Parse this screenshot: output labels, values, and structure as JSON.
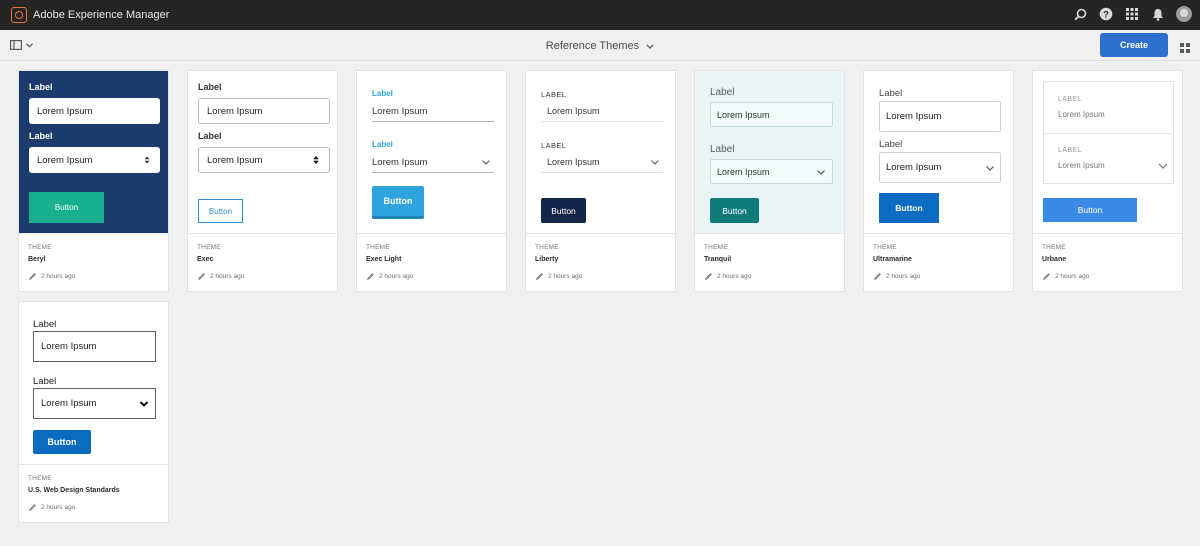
{
  "app": {
    "title": "Adobe Experience Manager"
  },
  "toolbar": {
    "page_title": "Reference Themes",
    "create_label": "Create"
  },
  "meta_kind_label": "THEME",
  "themes": [
    {
      "name": "Beryl",
      "time": "2 hours ago",
      "label1": "Label",
      "field1": "Lorem Ipsum",
      "label2": "Label",
      "field2": "Lorem Ipsum",
      "button": "Button"
    },
    {
      "name": "Exec",
      "time": "2 hours ago",
      "label1": "Label",
      "field1": "Lorem Ipsum",
      "label2": "Label",
      "field2": "Lorem Ipsum",
      "button": "Button"
    },
    {
      "name": "Exec Light",
      "time": "2 hours ago",
      "label1": "Label",
      "field1": "Lorem Ipsum",
      "label2": "Label",
      "field2": "Lorem Ipsum",
      "button": "Button"
    },
    {
      "name": "Liberty",
      "time": "2 hours ago",
      "label1": "LABEL",
      "field1": "Lorem Ipsum",
      "label2": "LABEL",
      "field2": "Lorem Ipsum",
      "button": "Button"
    },
    {
      "name": "Tranquil",
      "time": "2 hours ago",
      "label1": "Label",
      "field1": "Lorem Ipsum",
      "label2": "Label",
      "field2": "Lorem Ipsum",
      "button": "Button"
    },
    {
      "name": "Ultramarine",
      "time": "2 hours ago",
      "label1": "Label",
      "field1": "Lorem Ipsum",
      "label2": "Label",
      "field2": "Lorem Ipsum",
      "button": "Button"
    },
    {
      "name": "Urbane",
      "time": "2 hours ago",
      "label1": "LABEL",
      "field1": "Lorem Ipsum",
      "label2": "LABEL",
      "field2": "Lorem Ipsum",
      "button": "Button"
    },
    {
      "name": "U.S. Web Design Standards",
      "time": "2 hours ago",
      "label1": "Label",
      "field1": "Lorem Ipsum",
      "label2": "Label",
      "field2": "Lorem Ipsum",
      "button": "Button"
    }
  ],
  "colors": {
    "topbar": "#252525",
    "create_button": "#2d6fcc",
    "beryl_bg": "#1c3b6d",
    "beryl_button": "#18b08f",
    "exec_light_accent": "#2ea3dd",
    "liberty_button": "#13264a",
    "tranquil_bg": "#e9f5f5",
    "tranquil_button": "#117b7b",
    "ultramarine_button": "#0b6bc1",
    "urbane_button": "#3a8ae6",
    "uswds_button": "#0a6bbf"
  }
}
